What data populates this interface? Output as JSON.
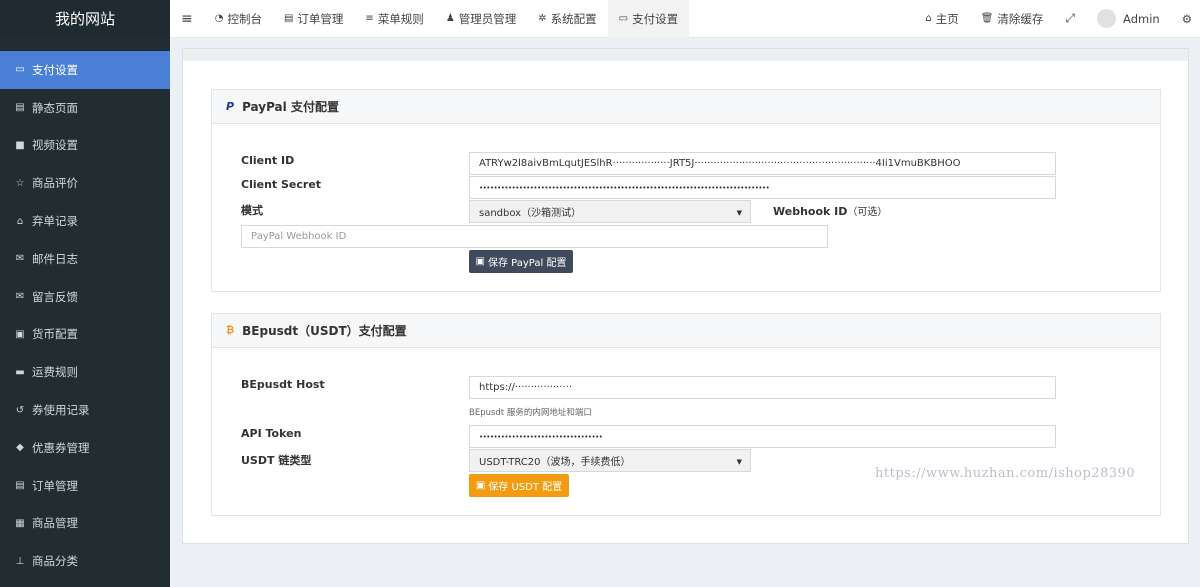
{
  "brand": "我的网站",
  "sidebar": {
    "items": [
      {
        "icon": "credit-card-icon",
        "glyph": "▭",
        "label": "支付设置",
        "active": true
      },
      {
        "icon": "file-icon",
        "glyph": "▤",
        "label": "静态页面"
      },
      {
        "icon": "video-icon",
        "glyph": "■",
        "label": "视频设置"
      },
      {
        "icon": "star-icon",
        "glyph": "☆",
        "label": "商品评价"
      },
      {
        "icon": "shop-icon",
        "glyph": "⌂",
        "label": "弃单记录"
      },
      {
        "icon": "mail-icon",
        "glyph": "✉",
        "label": "邮件日志"
      },
      {
        "icon": "envelope-icon",
        "glyph": "✉",
        "label": "留言反馈"
      },
      {
        "icon": "money-icon",
        "glyph": "▣",
        "label": "货币配置"
      },
      {
        "icon": "truck-icon",
        "glyph": "▬",
        "label": "运费规则"
      },
      {
        "icon": "history-icon",
        "glyph": "↺",
        "label": "券使用记录"
      },
      {
        "icon": "tag-icon",
        "glyph": "◆",
        "label": "优惠券管理"
      },
      {
        "icon": "list-icon",
        "glyph": "▤",
        "label": "订单管理"
      },
      {
        "icon": "gift-icon",
        "glyph": "▦",
        "label": "商品管理"
      },
      {
        "icon": "sitemap-icon",
        "glyph": "⊥",
        "label": "商品分类"
      }
    ]
  },
  "topbar": {
    "tabs": [
      {
        "name": "tab-dashboard",
        "icon": "dashboard-icon",
        "glyph": "◔",
        "label": "控制台"
      },
      {
        "name": "tab-orders",
        "icon": "list-icon",
        "glyph": "▤",
        "label": "订单管理"
      },
      {
        "name": "tab-menu-rules",
        "icon": "bars-icon",
        "glyph": "≡",
        "label": "菜单规则"
      },
      {
        "name": "tab-admins",
        "icon": "user-icon",
        "glyph": "♟",
        "label": "管理员管理"
      },
      {
        "name": "tab-system",
        "icon": "gear-icon",
        "glyph": "✲",
        "label": "系统配置"
      },
      {
        "name": "tab-payment",
        "icon": "credit-card-icon",
        "glyph": "▭",
        "label": "支付设置",
        "active": true
      }
    ],
    "home": "主页",
    "clear_cache": "清除缓存",
    "user": "Admin"
  },
  "paypal": {
    "title": "PayPal 支付配置",
    "client_id_label": "Client ID",
    "client_id_value": "ATRYw2l8aivBmLqutJESlhR··················JRT5J·························································4Ii1VmuBKBHOO",
    "client_secret_label": "Client Secret",
    "client_secret_value": "••••••••••••••••••••••••••••••••••••••••••••••••••••••••••••••••••••••••••••••••",
    "mode_label": "模式",
    "mode_value": "sandbox（沙箱测试）",
    "webhook_label": "Webhook ID",
    "webhook_optional": "（可选）",
    "webhook_placeholder": "PayPal Webhook ID",
    "save_label": "保存 PayPal 配置"
  },
  "usdt": {
    "title": "BEpusdt（USDT）支付配置",
    "host_label": "BEpusdt Host",
    "host_value": "https://··················",
    "host_help": "BEpusdt 服务的内网地址和端口",
    "token_label": "API Token",
    "token_value": "••••••••••••••••••••••••••••••••••",
    "chain_label": "USDT 链类型",
    "chain_value": "USDT-TRC20（波场，手续费低）",
    "save_label": "保存 USDT 配置"
  },
  "watermark": "https://www.huzhan.com/ishop28390",
  "colors": {
    "sidebar_bg": "#222d32",
    "sidebar_active": "#4a7fd6",
    "paypal_blue": "#253b80",
    "bitcoin_orange": "#f7931a",
    "usdt_button": "#f39c12",
    "paypal_button": "#3f4a5c"
  }
}
